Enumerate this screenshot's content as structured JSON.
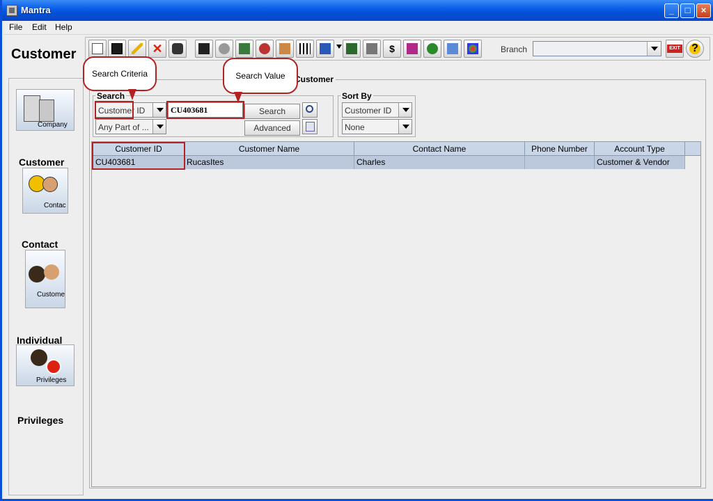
{
  "window": {
    "title": "Mantra"
  },
  "menu": [
    "File",
    "Edit",
    "Help"
  ],
  "header": {
    "title": "Customer"
  },
  "toolbar": {
    "buttons": [
      "new-icon",
      "save-icon",
      "edit-pencil-icon",
      "delete-x-icon",
      "binoculars-icon",
      "report-icon",
      "refresh-icon",
      "transfer-icon",
      "users-icon",
      "photo-icon",
      "grid-icon",
      "forms-icon",
      "film-icon",
      "document-icon",
      "money-icon",
      "g-report-icon",
      "recycle-icon",
      "window-icon",
      "palette-icon"
    ],
    "branch_label": "Branch",
    "branch_value": "",
    "exit_label": "EXIT"
  },
  "nav": [
    {
      "caption": "Company",
      "label": "Customer"
    },
    {
      "caption": "Contac",
      "label": "Contact"
    },
    {
      "caption": "Custome",
      "label": "Individual"
    },
    {
      "caption": "Privileges",
      "label": "Privileges"
    }
  ],
  "content": {
    "title": "Customer"
  },
  "search": {
    "group_title": "Search",
    "criteria": "Customer ID",
    "match": "Any Part of ...",
    "value": "CU403681",
    "search_button": "Search",
    "advanced_button": "Advanced"
  },
  "sort": {
    "group_title": "Sort By",
    "field": "Customer ID",
    "order": "None"
  },
  "callouts": {
    "criteria": "Search Criteria",
    "value": "Search Value"
  },
  "table": {
    "columns": [
      "Customer ID",
      "Customer Name",
      "Contact Name",
      "Phone Number",
      "Account Type"
    ],
    "rows": [
      [
        "CU403681",
        "RucasItes",
        "Charles",
        "",
        "Customer & Vendor"
      ]
    ]
  },
  "colors": {
    "title_bar": "#0a5fe8",
    "highlight": "#b22222",
    "row_selected": "#bcc9dc",
    "header_bg": "#c8d6e8"
  }
}
